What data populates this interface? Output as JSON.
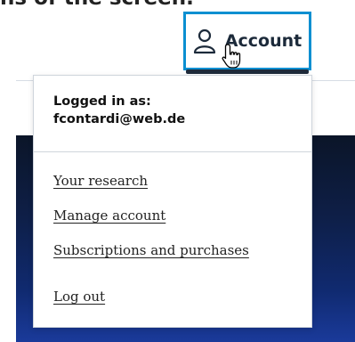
{
  "page_heading": "ns of the screen.",
  "header": {
    "account_label": "Account",
    "accent_color": "#0a8fd1"
  },
  "dropdown": {
    "logged_in_label": "Logged in as:",
    "logged_in_email": "fcontardi@web.de",
    "menu_items": [
      {
        "label": "Your research"
      },
      {
        "label": "Manage account"
      },
      {
        "label": "Subscriptions and purchases"
      },
      {
        "label": "Log out"
      }
    ]
  },
  "icons": {
    "account": "user-icon",
    "cursor": "hand-pointer-icon"
  }
}
